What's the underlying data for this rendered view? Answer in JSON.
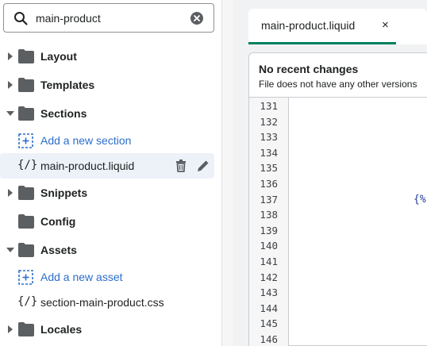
{
  "search": {
    "value": "main-product",
    "icon": "search-icon",
    "clear_icon": "clear-circle-icon"
  },
  "tree": {
    "items": [
      {
        "label": "Layout",
        "kind": "folder",
        "expanded": false
      },
      {
        "label": "Templates",
        "kind": "folder",
        "expanded": false
      },
      {
        "label": "Sections",
        "kind": "folder",
        "expanded": true
      },
      {
        "label": "Add a new section",
        "kind": "add-link"
      },
      {
        "label": "main-product.liquid",
        "kind": "file",
        "icon_text": "{/}",
        "selected": true
      },
      {
        "label": "Snippets",
        "kind": "folder",
        "expanded": false
      },
      {
        "label": "Config",
        "kind": "folder",
        "expanded": null
      },
      {
        "label": "Assets",
        "kind": "folder",
        "expanded": true
      },
      {
        "label": "Add a new asset",
        "kind": "add-link"
      },
      {
        "label": "section-main-product.css",
        "kind": "file",
        "icon_text": "{/}"
      },
      {
        "label": "Locales",
        "kind": "folder",
        "expanded": false
      }
    ]
  },
  "tab": {
    "label": "main-product.liquid",
    "close": "×"
  },
  "panel": {
    "title": "No recent changes",
    "subtitle": "File does not have any other versions"
  },
  "editor": {
    "line_numbers": [
      "131",
      "132",
      "133",
      "134",
      "135",
      "136",
      "137",
      "138",
      "139",
      "140",
      "141",
      "142",
      "143",
      "144",
      "145",
      "146"
    ],
    "visible_fragment": "{%"
  },
  "colors": {
    "accent": "#008060",
    "link": "#2c6ecb",
    "selected_bg": "#edf2f9"
  }
}
